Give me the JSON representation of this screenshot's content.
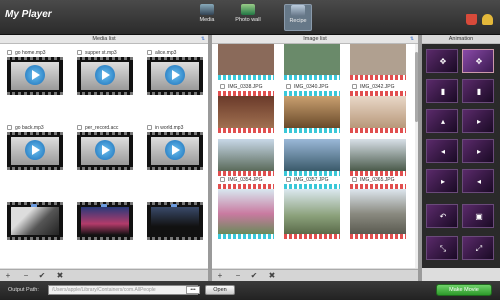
{
  "app": {
    "title": "My Player"
  },
  "nav": {
    "tabs": [
      {
        "label": "Media",
        "icon": "media-icon"
      },
      {
        "label": "Photo wall",
        "icon": "photo-wall-icon"
      },
      {
        "label": "Recipe",
        "icon": "recipe-icon",
        "active": true
      }
    ],
    "cart_icon": "shopping-cart-icon",
    "key_icon": "register-key-icon"
  },
  "media_list": {
    "title": "Media list",
    "items": [
      {
        "label": "go home.mp3",
        "kind": "audio"
      },
      {
        "label": "supper st.mp3",
        "kind": "audio"
      },
      {
        "label": "alice.mp3",
        "kind": "audio"
      },
      {
        "label": "go back.mp3",
        "kind": "audio"
      },
      {
        "label": "per_record.acc",
        "kind": "audio"
      },
      {
        "label": "in world.mp3",
        "kind": "audio"
      },
      {
        "label": "",
        "kind": "video"
      },
      {
        "label": "",
        "kind": "video"
      },
      {
        "label": "",
        "kind": "video"
      }
    ]
  },
  "image_list": {
    "title": "Image list",
    "items": [
      {
        "label": "",
        "color": "#8a6a5a"
      },
      {
        "label": "",
        "color": "#6a8a6a"
      },
      {
        "label": "",
        "color": "#b0a090"
      },
      {
        "label": "IMG_0338.JPG",
        "color": "#8a5a4a"
      },
      {
        "label": "IMG_0340.JPG",
        "color": "#a9885a"
      },
      {
        "label": "IMG_0342.JPG",
        "color": "#c9a888"
      },
      {
        "label": "",
        "color": "#7a8a7a"
      },
      {
        "label": "",
        "color": "#5a7a8a"
      },
      {
        "label": "",
        "color": "#6a7a6a"
      },
      {
        "label": "IMG_0354.JPG",
        "color": "#b07a9a"
      },
      {
        "label": "IMG_0357.JPG",
        "color": "#8a9a7a"
      },
      {
        "label": "IMG_0365.JPG",
        "color": "#9a9a90"
      }
    ]
  },
  "animation": {
    "title": "Animation",
    "tiles": [
      "✥",
      "✥",
      "▮",
      "▮",
      "▴",
      "▸",
      "◂",
      "▸",
      "▸",
      "◂",
      "↶",
      "▣",
      "⤡",
      "⤢"
    ]
  },
  "toolbar": {
    "add": "+",
    "remove": "−",
    "check": "✔",
    "clear": "✖"
  },
  "status": {
    "output_label": "Output Path:",
    "output_path": "/Users/apple/Library/Containers/com.AllPeople",
    "browse": "•••",
    "open": "Open",
    "make": "Make Movie"
  }
}
